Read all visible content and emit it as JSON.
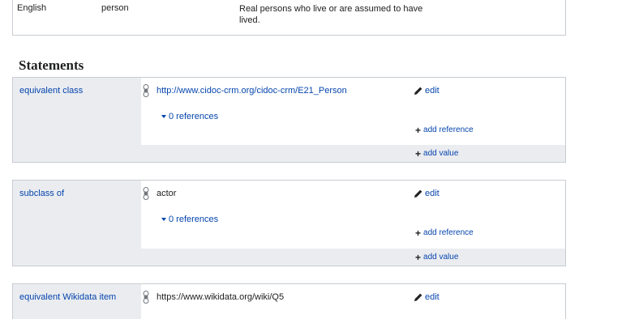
{
  "term": {
    "language": "English",
    "label": "person",
    "description": "Real persons who live or are assumed to have lived."
  },
  "statements_heading": "Statements",
  "statements": [
    {
      "property": "equivalent class",
      "value": "http://www.cidoc-crm.org/cidoc-crm/E21_Person",
      "edit_label": "edit",
      "references_label": "0 references",
      "add_reference_label": "add reference",
      "add_value_label": "add value"
    },
    {
      "property": "subclass of",
      "value": "actor",
      "edit_label": "edit",
      "references_label": "0 references",
      "add_reference_label": "add reference",
      "add_value_label": "add value"
    },
    {
      "property": "equivalent Wikidata item",
      "value": "https://www.wikidata.org/wiki/Q5",
      "edit_label": "edit"
    }
  ],
  "icons": {
    "rank": "rank-normal-icon",
    "edit": "pencil-icon",
    "add": "plus-icon",
    "expand": "caret-down-icon"
  },
  "colors": {
    "link": "#0645ad",
    "text": "#202122",
    "panel": "#eaecf0",
    "border": "#c8ccd1"
  }
}
